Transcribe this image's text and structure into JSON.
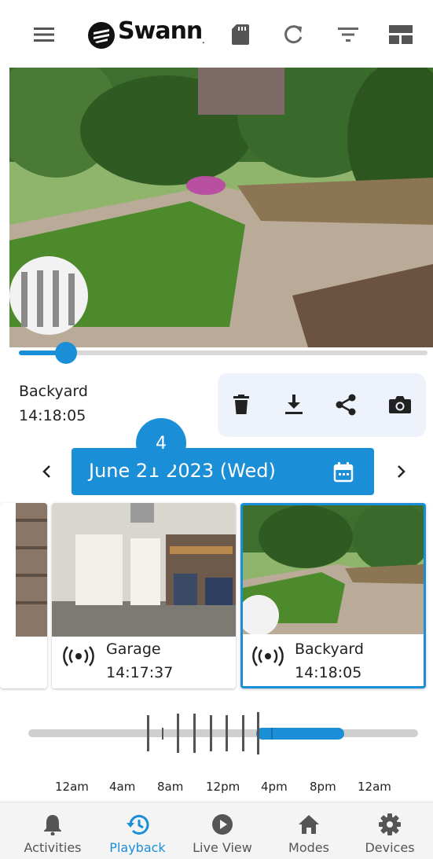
{
  "header": {
    "logo_text": "Swann",
    "logo_reg": "."
  },
  "player": {
    "progress": 0.12
  },
  "camera": {
    "name": "Backyard",
    "time": "14:18:05"
  },
  "date_bar": {
    "badge": "4",
    "date": "June 21 2023 (Wed)"
  },
  "clips": [
    {
      "name": "Garage",
      "time": "14:17:37"
    },
    {
      "name": "Backyard",
      "time": "14:18:05",
      "selected": true
    }
  ],
  "timeline": {
    "labels": [
      "12am",
      "4am",
      "8am",
      "12pm",
      "4pm",
      "8pm",
      "12am"
    ]
  },
  "nav": {
    "items": [
      {
        "label": "Activities",
        "icon": "bell-icon"
      },
      {
        "label": "Playback",
        "icon": "history-icon",
        "active": true
      },
      {
        "label": "Live View",
        "icon": "play-circle-icon"
      },
      {
        "label": "Modes",
        "icon": "home-icon"
      },
      {
        "label": "Devices",
        "icon": "gear-icon"
      }
    ]
  },
  "colors": {
    "accent": "#1a8fd8",
    "action_bg": "#eef3fb"
  }
}
